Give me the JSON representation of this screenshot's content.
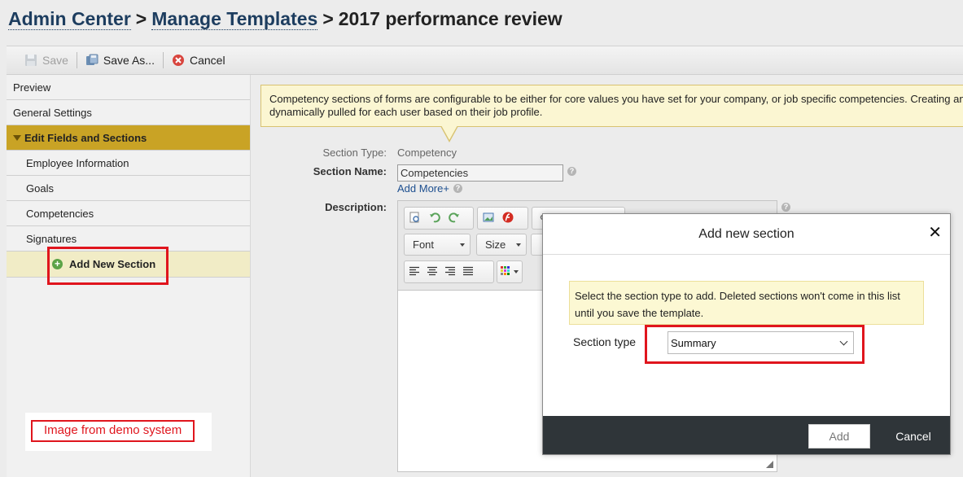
{
  "breadcrumb": {
    "items": [
      "Admin Center",
      "Manage Templates"
    ],
    "separator": ">",
    "current": "2017 performance review"
  },
  "toolbar": {
    "save_label": "Save",
    "save_as_label": "Save As...",
    "cancel_label": "Cancel"
  },
  "sidebar": {
    "items": [
      {
        "label": "Preview"
      },
      {
        "label": "General Settings"
      },
      {
        "label": "Edit Fields and Sections"
      },
      {
        "label": "Employee Information"
      },
      {
        "label": "Goals"
      },
      {
        "label": "Competencies"
      },
      {
        "label": "Signatures"
      },
      {
        "label": "Add New Section"
      }
    ]
  },
  "demo_note": "Image from demo system",
  "main": {
    "banner_line1": "Competency sections of forms are configurable to be either for core values you have set for your company, or job specific competencies. Creating and",
    "banner_line2": "dynamically pulled for each user based on their job profile.",
    "section_type_label": "Section Type:",
    "section_type_value": "Competency",
    "section_name_label": "Section Name:",
    "section_name_value": "Competencies",
    "add_more": "Add More+",
    "description_label": "Description:",
    "editor": {
      "font_label": "Font",
      "size_label": "Size"
    }
  },
  "modal": {
    "title": "Add new section",
    "close": "✕",
    "note": "Select the section type to add. Deleted sections won't come in this list until you save the template.",
    "section_type_label": "Section type",
    "section_type_value": "Summary",
    "add_button": "Add",
    "cancel_button": "Cancel"
  },
  "colors": {
    "accent_gold": "#c9a325",
    "highlight_red": "#e0151d",
    "breadcrumb_link": "#1d3d5f",
    "modal_footer": "#2f3539"
  }
}
